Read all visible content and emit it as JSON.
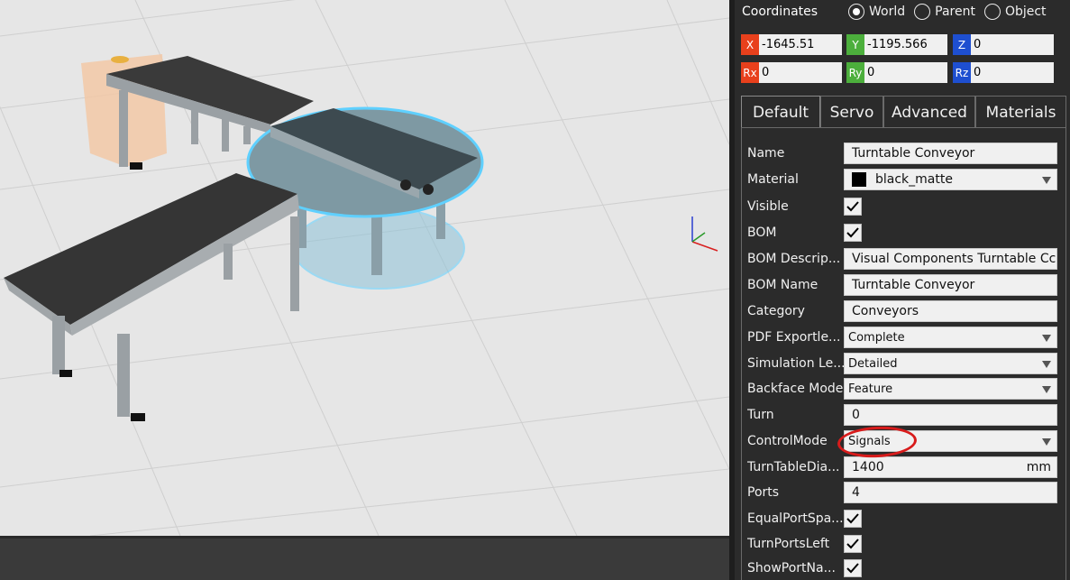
{
  "coordinates": {
    "title": "Coordinates",
    "options": [
      "World",
      "Parent",
      "Object"
    ],
    "selected": "World",
    "fields": [
      {
        "axis": "X",
        "value": "-1645.51",
        "color": "#e8401c"
      },
      {
        "axis": "Y",
        "value": "-1195.566",
        "color": "#4caf3c"
      },
      {
        "axis": "Z",
        "value": "0",
        "color": "#1e4fd0"
      },
      {
        "axis": "Rx",
        "value": "0",
        "color": "#e8401c"
      },
      {
        "axis": "Ry",
        "value": "0",
        "color": "#4caf3c"
      },
      {
        "axis": "Rz",
        "value": "0",
        "color": "#1e4fd0"
      }
    ]
  },
  "tabs": [
    "Default",
    "Servo",
    "Advanced",
    "Materials"
  ],
  "active_tab": "Default",
  "properties": {
    "name": {
      "label": "Name",
      "value": "Turntable Conveyor"
    },
    "material": {
      "label": "Material",
      "value": "black_matte",
      "swatch": "#000000"
    },
    "visible": {
      "label": "Visible",
      "checked": true
    },
    "bom": {
      "label": "BOM",
      "checked": true
    },
    "bom_description": {
      "label": "BOM Descrip...",
      "value": "Visual Components Turntable Cc"
    },
    "bom_name": {
      "label": "BOM Name",
      "value": "Turntable Conveyor"
    },
    "category": {
      "label": "Category",
      "value": "Conveyors"
    },
    "pdf_export": {
      "label": "PDF Exportle...",
      "value": "Complete"
    },
    "simulation_level": {
      "label": "Simulation Le...",
      "value": "Detailed"
    },
    "backface_mode": {
      "label": "Backface Mode",
      "value": "Feature"
    },
    "turn": {
      "label": "Turn",
      "value": "0"
    },
    "control_mode": {
      "label": "ControlMode",
      "value": "Signals"
    },
    "turntable_diameter": {
      "label": "TurnTableDia...",
      "value": "1400",
      "unit": "mm"
    },
    "ports": {
      "label": "Ports",
      "value": "4"
    },
    "equal_port_spacing": {
      "label": "EqualPortSpa...",
      "checked": true
    },
    "turn_ports_left": {
      "label": "TurnPortsLeft",
      "checked": true
    },
    "show_port_names": {
      "label": "ShowPortNa...",
      "checked": true
    }
  },
  "colors": {
    "panel_bg": "#2b2b2b",
    "viewport_bg": "#e6e6e6",
    "selection_highlight": "#5fd0ff",
    "annotation": "#d81b1b"
  }
}
